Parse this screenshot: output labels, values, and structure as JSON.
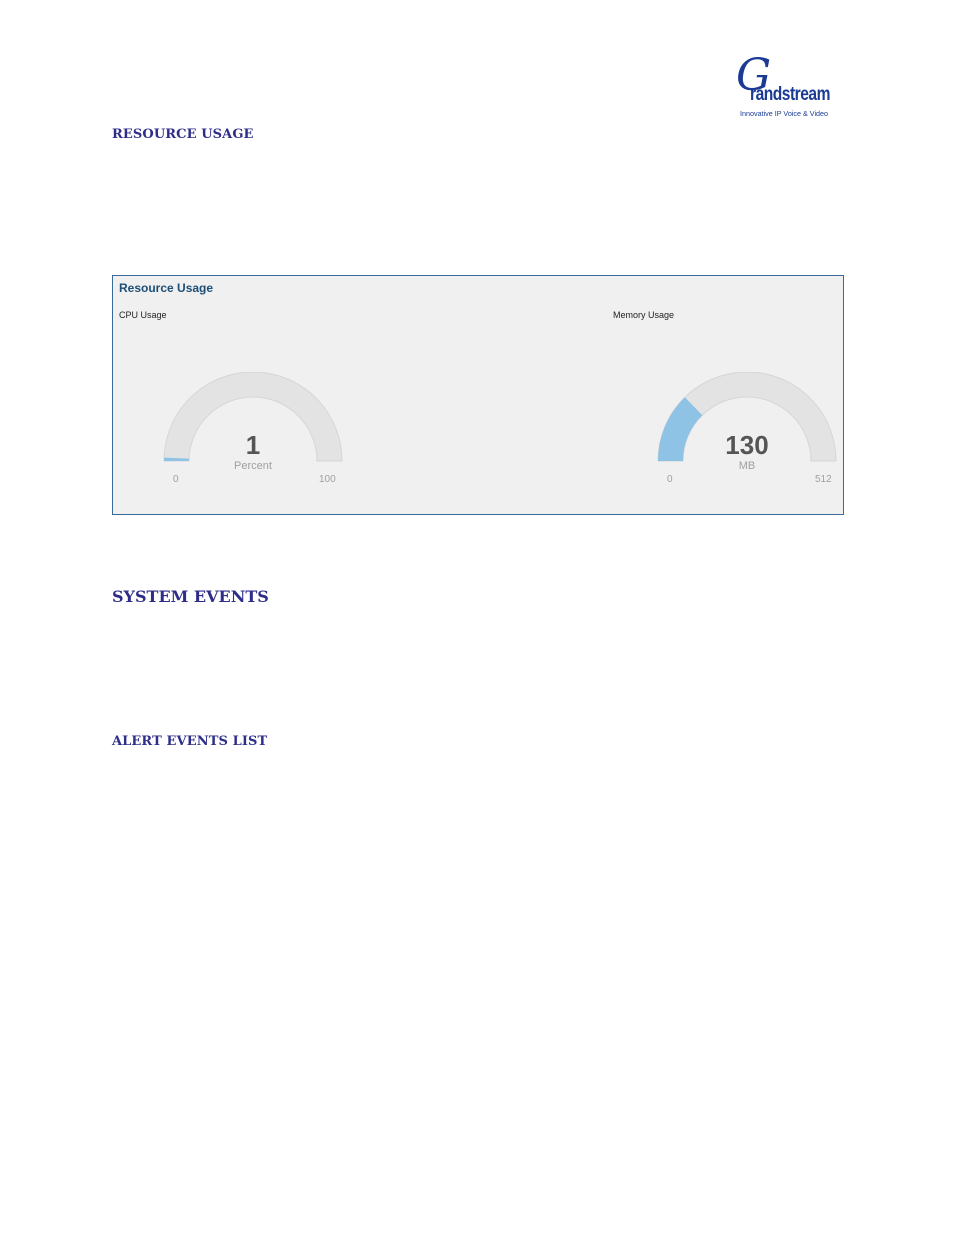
{
  "logo": {
    "initial": "G",
    "word": "randstream",
    "tagline": "Innovative IP Voice & Video"
  },
  "sections": {
    "resource_usage": "RESOURCE USAGE",
    "system_events": "SYSTEM EVENTS",
    "alert_events_list": "ALERT EVENTS LIST"
  },
  "panel": {
    "title": "Resource Usage"
  },
  "gauges": [
    {
      "label": "CPU Usage",
      "value": 1,
      "value_text": "1",
      "unit": "Percent",
      "min": 0,
      "max": 100,
      "min_text": "0",
      "max_text": "100"
    },
    {
      "label": "Memory Usage",
      "value": 130,
      "value_text": "130",
      "unit": "MB",
      "min": 0,
      "max": 512,
      "min_text": "0",
      "max_text": "512"
    }
  ],
  "colors": {
    "heading": "#2e2e8a",
    "panel_title": "#1d4f76",
    "panel_border": "#3a6a9a",
    "gauge_track": "#e3e3e3",
    "gauge_fill": "#8ec3e6",
    "brand": "#1a3a94"
  }
}
